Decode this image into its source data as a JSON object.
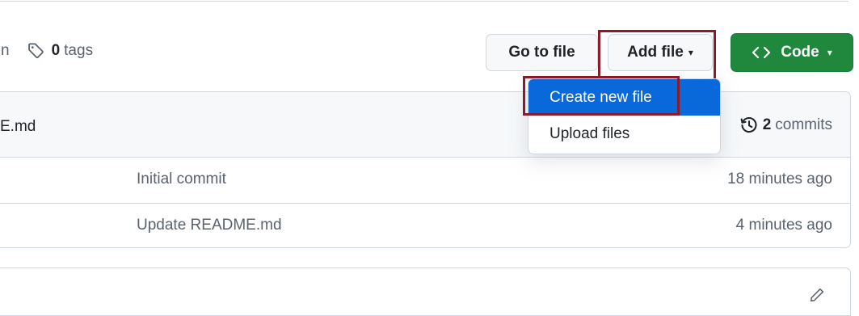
{
  "toolbar": {
    "branch_fragment": "n",
    "tags_count": "0",
    "tags_label": "tags",
    "goto_file_label": "Go to file",
    "add_file_label": "Add file",
    "code_label": "Code"
  },
  "add_file_menu": {
    "items": [
      {
        "label": "Create new file",
        "state": "highlighted"
      },
      {
        "label": "Upload files",
        "state": "normal"
      }
    ]
  },
  "file_list": {
    "header": {
      "file_fragment": "E.md",
      "commits_count": "2",
      "commits_label": "commits"
    },
    "rows": [
      {
        "message": "Initial commit",
        "time": "18 minutes ago"
      },
      {
        "message": "Update README.md",
        "time": "4 minutes ago"
      }
    ]
  },
  "icons": {
    "tags": "tag-icon",
    "code": "code-brackets-icon",
    "history": "history-clock-icon",
    "edit": "pencil-icon",
    "caret": "caret-down-icon"
  },
  "colors": {
    "primary_green": "#1f883d",
    "menu_highlight_blue": "#0969da",
    "annotation_red": "#8b1a2b",
    "muted_text": "#59636e",
    "border": "#d0d7de",
    "header_bg": "#f6f8fa"
  }
}
